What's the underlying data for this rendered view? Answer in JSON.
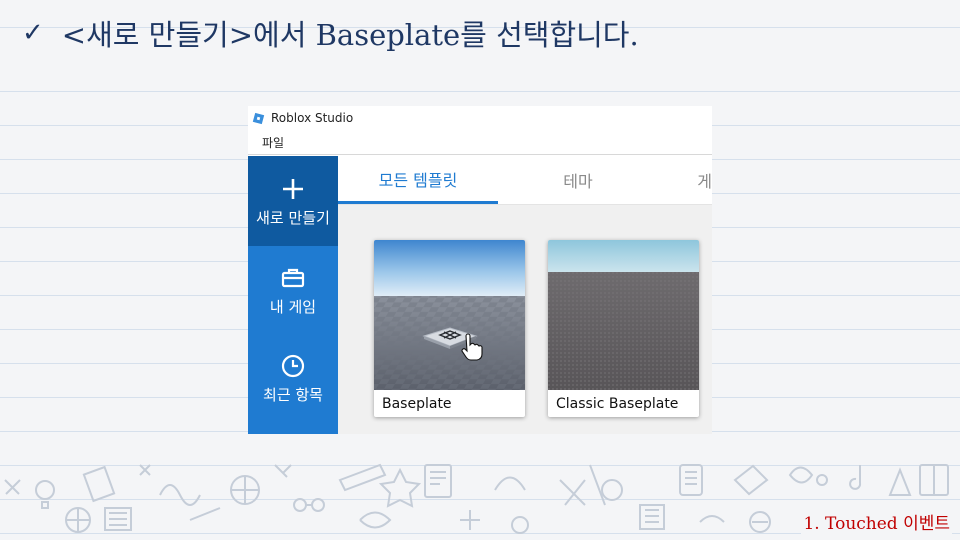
{
  "slide": {
    "title": "<새로 만들기>에서 Baseplate를 선택합니다.",
    "check_icon": "✓",
    "footer": "1. Touched 이벤트"
  },
  "studio": {
    "app_title": "Roblox Studio",
    "menu": {
      "file": "파일"
    },
    "sidebar": [
      {
        "label": "새로 만들기",
        "icon": "plus-icon",
        "active": true
      },
      {
        "label": "내 게임",
        "icon": "briefcase-icon",
        "active": false
      },
      {
        "label": "최근 항목",
        "icon": "clock-icon",
        "active": false
      }
    ],
    "tabs": [
      {
        "label": "모든 템플릿",
        "active": true
      },
      {
        "label": "테마",
        "active": false
      },
      {
        "label": "게",
        "active": false
      }
    ],
    "templates": [
      {
        "name": "Baseplate"
      },
      {
        "name": "Classic Baseplate"
      }
    ]
  },
  "colors": {
    "title_text": "#1f3864",
    "footer_text": "#c00000",
    "sidebar_bg": "#1f7bd1",
    "sidebar_active": "#0f5aa0",
    "tab_active": "#1f7bd1"
  }
}
